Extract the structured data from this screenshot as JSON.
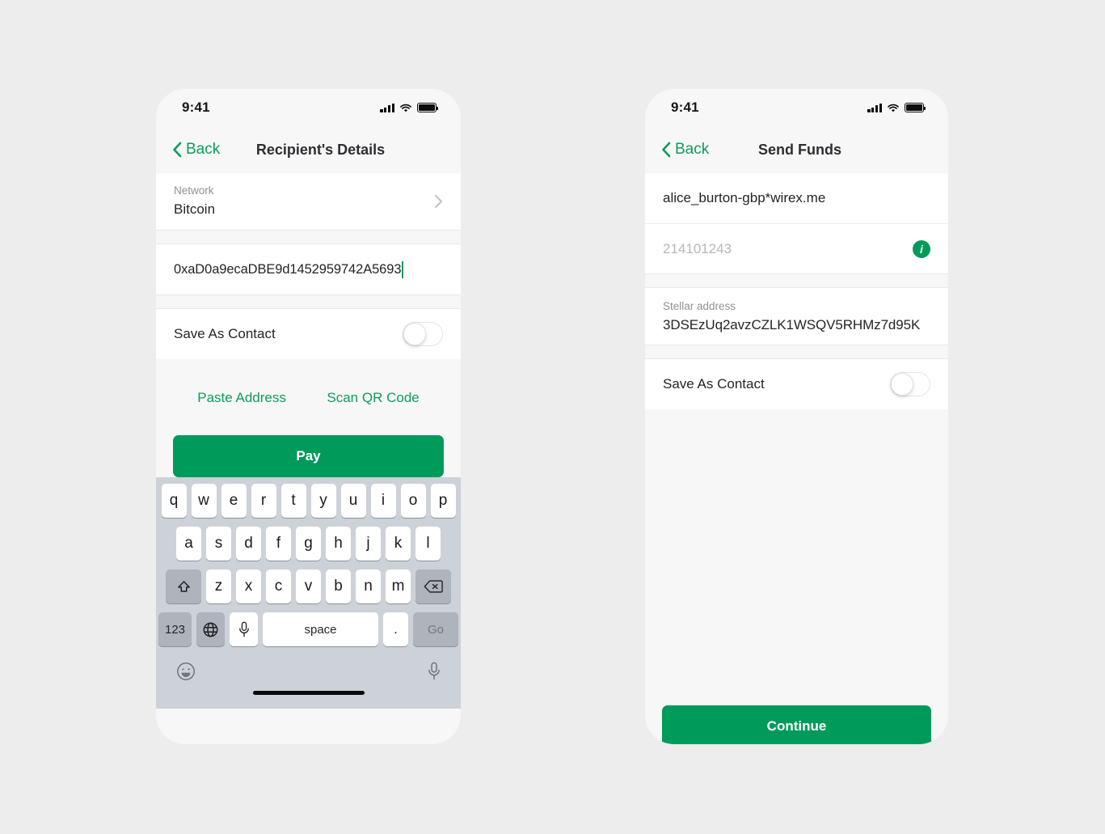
{
  "theme": {
    "accent": "#009b5b",
    "link": "#0d9c5c",
    "page_bg": "#ededed",
    "phone_bg": "#f7f7f7"
  },
  "left_screen": {
    "status": {
      "time": "9:41",
      "signal_icon": "cellular-bars-icon",
      "wifi_icon": "wifi-icon",
      "battery_icon": "battery-full-icon"
    },
    "nav": {
      "back_label": "Back",
      "title": "Recipient's Details"
    },
    "network": {
      "label": "Network",
      "value": "Bitcoin",
      "chevron_icon": "chevron-right-icon"
    },
    "address": {
      "value": "0xaD0a9ecaDBE9d1452959742A5693"
    },
    "save_contact": {
      "label": "Save As Contact",
      "state": "off"
    },
    "actions": {
      "paste": "Paste Address",
      "scan": "Scan QR Code",
      "primary": "Pay"
    },
    "keyboard": {
      "row1": [
        "q",
        "w",
        "e",
        "r",
        "t",
        "y",
        "u",
        "i",
        "o",
        "p"
      ],
      "row2": [
        "a",
        "s",
        "d",
        "f",
        "g",
        "h",
        "j",
        "k",
        "l"
      ],
      "row3_letters": [
        "z",
        "x",
        "c",
        "v",
        "b",
        "n",
        "m"
      ],
      "shift": "shift-icon",
      "delete": "backspace-icon",
      "numbers": "123",
      "globe": "globe-icon",
      "dictate": "microphone-icon",
      "space": "space",
      "period": ".",
      "go": "Go",
      "emoji": "emoji-smiley-icon",
      "dictate_bottom": "microphone-icon"
    }
  },
  "right_screen": {
    "status": {
      "time": "9:41",
      "signal_icon": "cellular-bars-icon",
      "wifi_icon": "wifi-icon",
      "battery_icon": "battery-full-icon"
    },
    "nav": {
      "back_label": "Back",
      "title": "Send Funds"
    },
    "recipient": {
      "handle": "alice_burton-gbp*wirex.me",
      "reference": "214101243",
      "info_icon": "info-circle-icon"
    },
    "stellar": {
      "label": "Stellar address",
      "value": "3DSEzUq2avzCZLK1WSQV5RHMz7d95K"
    },
    "save_contact": {
      "label": "Save As Contact",
      "state": "off"
    },
    "actions": {
      "primary": "Continue"
    }
  }
}
